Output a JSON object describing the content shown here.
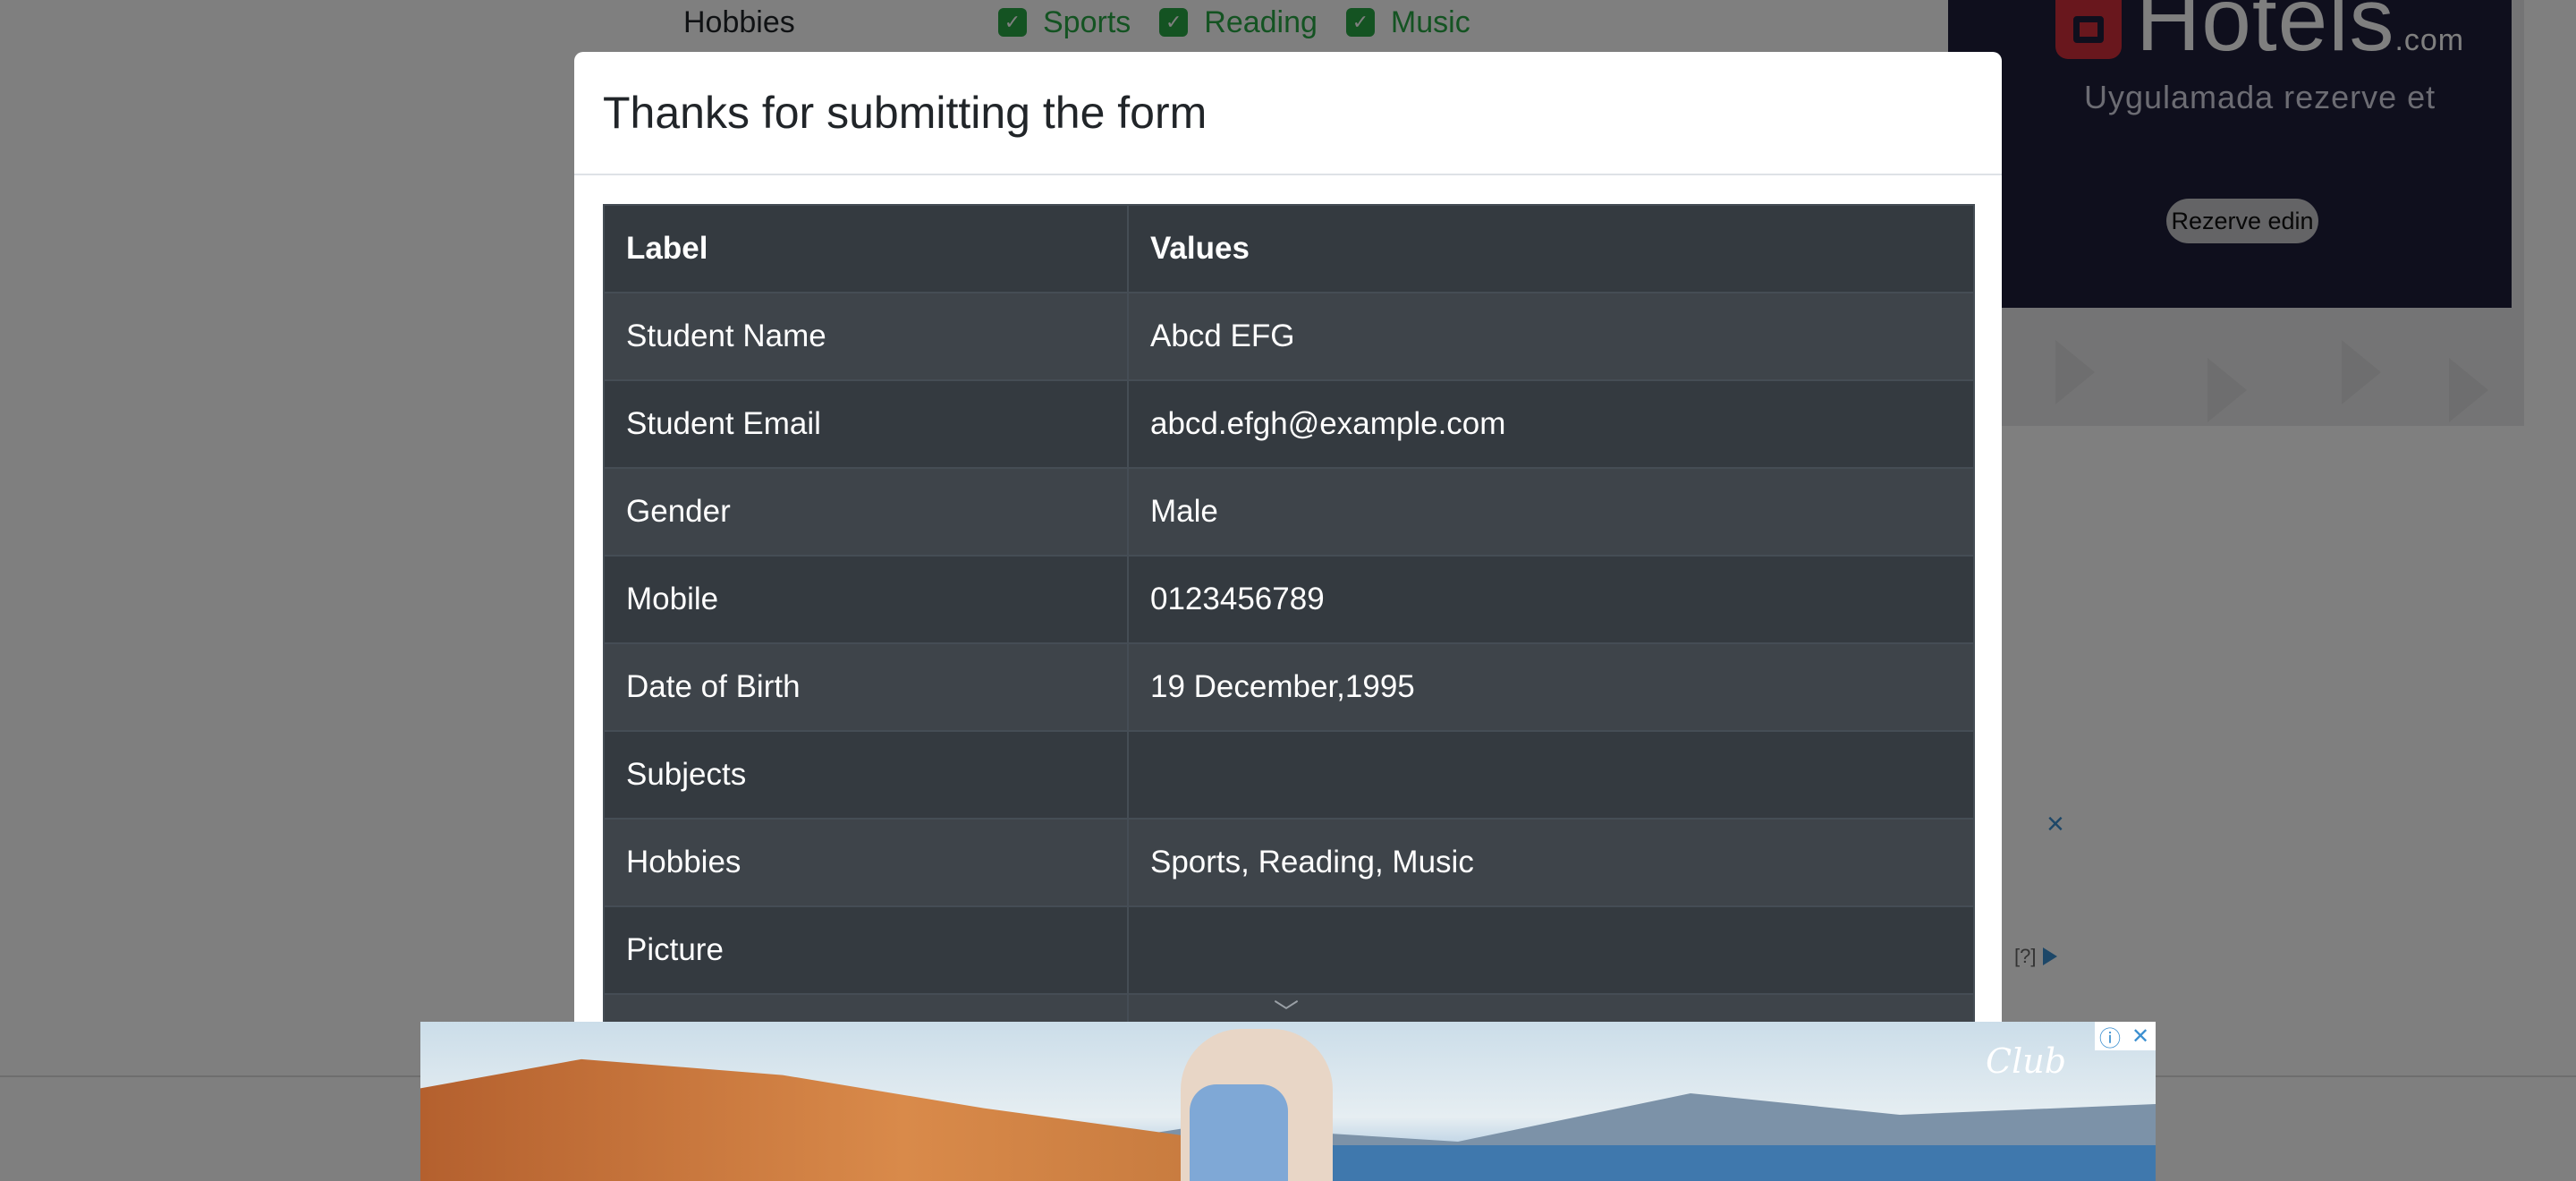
{
  "background": {
    "hobbies_label": "Hobbies",
    "hobbies": [
      {
        "label": "Sports",
        "checked": true
      },
      {
        "label": "Reading",
        "checked": true
      },
      {
        "label": "Music",
        "checked": true
      }
    ],
    "check_color": "#28a745"
  },
  "side_ad": {
    "brand": "Hotels",
    "brand_suffix": ".com",
    "tagline": "Uygulamada rezerve et",
    "button": "Rezerve edin",
    "close_glyph": "×",
    "adchoice": "[?]"
  },
  "modal": {
    "title": "Thanks for submitting the form",
    "table": {
      "headers": [
        "Label",
        "Values"
      ],
      "rows": [
        {
          "label": "Student Name",
          "value": "Abcd EFG"
        },
        {
          "label": "Student Email",
          "value": "abcd.efgh@example.com"
        },
        {
          "label": "Gender",
          "value": "Male"
        },
        {
          "label": "Mobile",
          "value": "0123456789"
        },
        {
          "label": "Date of Birth",
          "value": "19 December,1995"
        },
        {
          "label": "Subjects",
          "value": ""
        },
        {
          "label": "Hobbies",
          "value": "Sports, Reading, Music"
        },
        {
          "label": "Picture",
          "value": ""
        }
      ]
    },
    "table_dark": "#343a40",
    "table_striped": "#3e444a"
  },
  "banner_ad": {
    "brand": "Club",
    "info_glyph": "ⓘ",
    "close_glyph": "✕"
  }
}
